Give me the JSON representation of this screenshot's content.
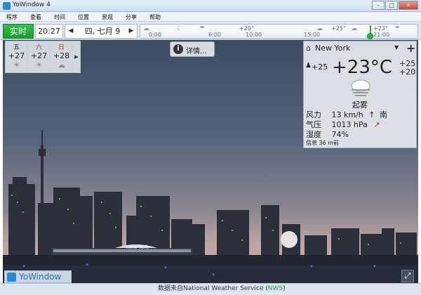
{
  "window": {
    "title": "YoWindow 4"
  },
  "menu": [
    "程序",
    "查看",
    "时间",
    "位置",
    "景观",
    "分享",
    "帮助"
  ],
  "toolbar": {
    "now_label": "实时",
    "time": "20:27",
    "date": "四, 七月 9",
    "timeline": {
      "start_label": "0:00",
      "times": [
        "6:00",
        "10:00",
        "15:00",
        "21:00"
      ],
      "temps": [
        "+20°",
        "+25°",
        "+23°"
      ]
    }
  },
  "forecast_mini": [
    {
      "day": "五",
      "temp": "+27",
      "icon": "sun-cloud-icon",
      "weekend": false
    },
    {
      "day": "六",
      "temp": "+27",
      "icon": "sun-cloud-icon",
      "weekend": true
    },
    {
      "day": "日",
      "temp": "+28",
      "icon": "cloud-icon",
      "weekend": true
    }
  ],
  "details_label": "详情...",
  "panel": {
    "city": "New York",
    "feels_like": "+25",
    "temperature": "+23°C",
    "high": "+25",
    "low": "+20",
    "condition": "起雾",
    "wind_label": "风力",
    "wind_value": "13 km/h",
    "wind_dir": "南",
    "pressure_label": "气压",
    "pressure_value": "1013 hPa",
    "humidity_label": "湿度",
    "humidity_value": "74%",
    "updated": "信息  36 m前"
  },
  "scene": {
    "stadium_sign": "New York"
  },
  "footer": {
    "logo": "YoWindow",
    "source_prefix": "数据来自National Weather Service (",
    "source_nws": "NWS",
    "source_suffix": ")"
  },
  "colors": {
    "now_green": "#1d9a30",
    "weekend_red": "#c8261a",
    "logo_blue": "#2a6fbf"
  }
}
